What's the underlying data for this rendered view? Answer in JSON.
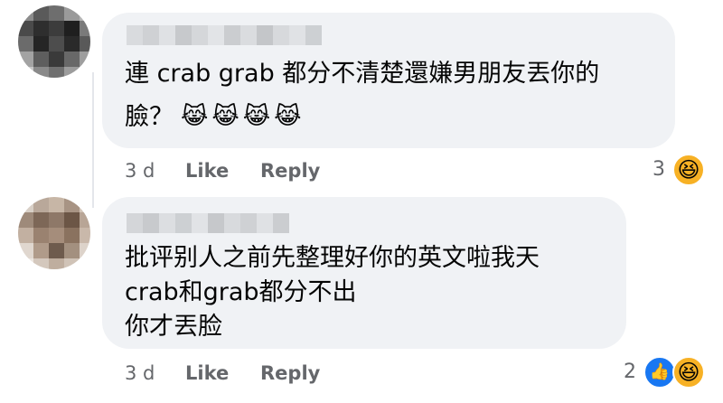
{
  "comments": [
    {
      "text_lines": [
        "連 crab grab 都分不清楚還嫌男朋友丟你的",
        "臉？"
      ],
      "emojis": [
        "😹",
        "😹",
        "😹",
        "😹"
      ],
      "time": "3 d",
      "like_label": "Like",
      "reply_label": "Reply",
      "reaction_count": "3",
      "reactions": [
        "haha"
      ]
    },
    {
      "text_lines": [
        "批评别人之前先整理好你的英文啦我天",
        "crab和grab都分不出",
        "你才丟脸"
      ],
      "emojis": [],
      "time": "3 d",
      "like_label": "Like",
      "reply_label": "Reply",
      "reaction_count": "2",
      "reactions": [
        "like",
        "haha"
      ]
    }
  ],
  "icons": {
    "haha": "😆",
    "like": "👍",
    "cat_laugh": "😹"
  },
  "colors": {
    "bubble": "#f0f2f5",
    "meta_text": "#65676b",
    "like_blue": "#1877f2",
    "haha_yellow": "#f7b125"
  }
}
